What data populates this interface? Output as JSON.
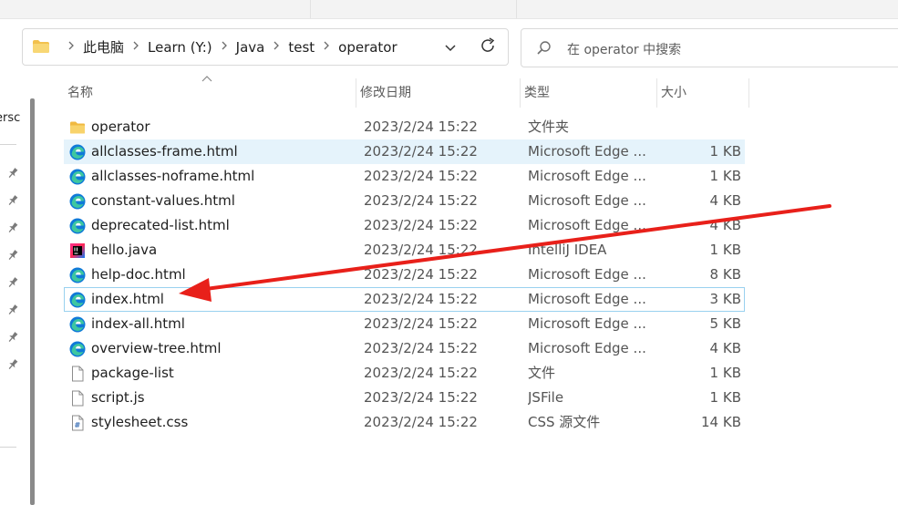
{
  "address": {
    "crumbs": [
      "此电脑",
      "Learn (Y:)",
      "Java",
      "test",
      "operator"
    ]
  },
  "search": {
    "placeholder": "在 operator 中搜索"
  },
  "sidebar": {
    "fragments": [
      "ersc",
      ")"
    ]
  },
  "columns": {
    "name": "名称",
    "date": "修改日期",
    "type": "类型",
    "size": "大小"
  },
  "files": [
    {
      "icon": "folder-icon",
      "name": "operator",
      "date": "2023/2/24 15:22",
      "type": "文件夹",
      "size": ""
    },
    {
      "icon": "edge-icon",
      "name": "allclasses-frame.html",
      "date": "2023/2/24 15:22",
      "type": "Microsoft Edge ...",
      "size": "1 KB"
    },
    {
      "icon": "edge-icon",
      "name": "allclasses-noframe.html",
      "date": "2023/2/24 15:22",
      "type": "Microsoft Edge ...",
      "size": "1 KB"
    },
    {
      "icon": "edge-icon",
      "name": "constant-values.html",
      "date": "2023/2/24 15:22",
      "type": "Microsoft Edge ...",
      "size": "4 KB"
    },
    {
      "icon": "edge-icon",
      "name": "deprecated-list.html",
      "date": "2023/2/24 15:22",
      "type": "Microsoft Edge ...",
      "size": "4 KB"
    },
    {
      "icon": "intellij-icon",
      "name": "hello.java",
      "date": "2023/2/24 15:22",
      "type": "IntelliJ IDEA",
      "size": "1 KB"
    },
    {
      "icon": "edge-icon",
      "name": "help-doc.html",
      "date": "2023/2/24 15:22",
      "type": "Microsoft Edge ...",
      "size": "8 KB"
    },
    {
      "icon": "edge-icon",
      "name": "index.html",
      "date": "2023/2/24 15:22",
      "type": "Microsoft Edge ...",
      "size": "3 KB"
    },
    {
      "icon": "edge-icon",
      "name": "index-all.html",
      "date": "2023/2/24 15:22",
      "type": "Microsoft Edge ...",
      "size": "5 KB"
    },
    {
      "icon": "edge-icon",
      "name": "overview-tree.html",
      "date": "2023/2/24 15:22",
      "type": "Microsoft Edge ...",
      "size": "4 KB"
    },
    {
      "icon": "file-icon",
      "name": "package-list",
      "date": "2023/2/24 15:22",
      "type": "文件",
      "size": "1 KB"
    },
    {
      "icon": "file-icon",
      "name": "script.js",
      "date": "2023/2/24 15:22",
      "type": "JSFile",
      "size": "1 KB"
    },
    {
      "icon": "css-file-icon",
      "name": "stylesheet.css",
      "date": "2023/2/24 15:22",
      "type": "CSS 源文件",
      "size": "14 KB"
    }
  ],
  "hovered_index": 1,
  "focused_index": 7,
  "annotation_color": "#e8201a"
}
